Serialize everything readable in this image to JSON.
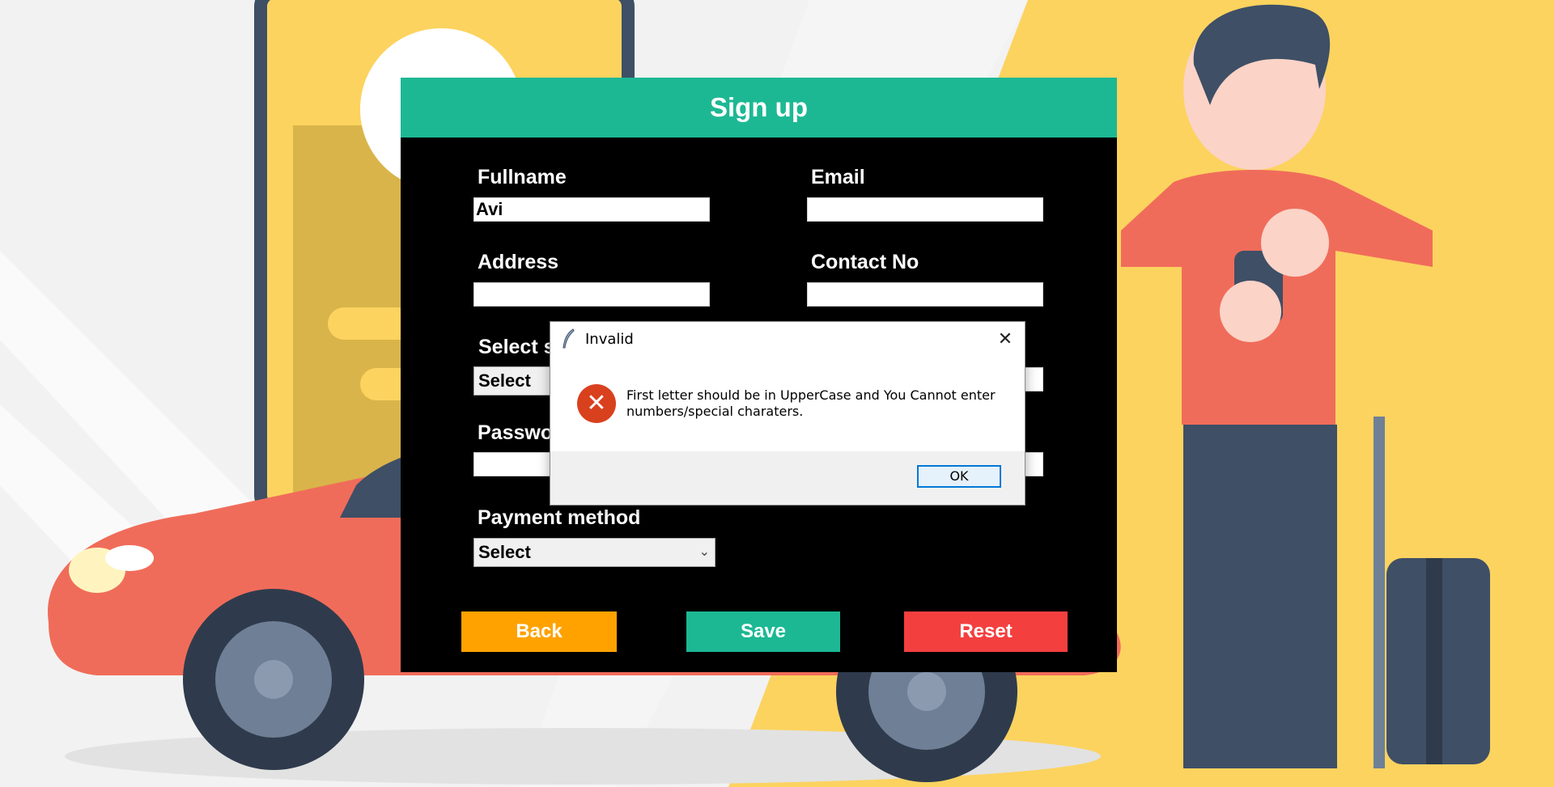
{
  "form": {
    "title": "Sign up",
    "fullname_label": "Fullname",
    "fullname_value": "Avi",
    "email_label": "Email",
    "email_value": "",
    "address_label": "Address",
    "address_value": "",
    "contact_label": "Contact No",
    "contact_value": "",
    "select_label_partial": "Select s",
    "select_value": "Select",
    "password_label_partial": "Passwo",
    "payment_label": "Payment method",
    "payment_value": "Select",
    "back_label": "Back",
    "save_label": "Save",
    "reset_label": "Reset"
  },
  "dialog": {
    "title": "Invalid",
    "message": "First letter should be in UpperCase and You Cannot enter numbers/special charaters.",
    "ok_label": "OK",
    "icon": "error-icon"
  },
  "colors": {
    "header": "#1cb894",
    "back": "#ffa200",
    "save": "#1cb894",
    "reset": "#f43f3f",
    "error": "#d9411e"
  }
}
